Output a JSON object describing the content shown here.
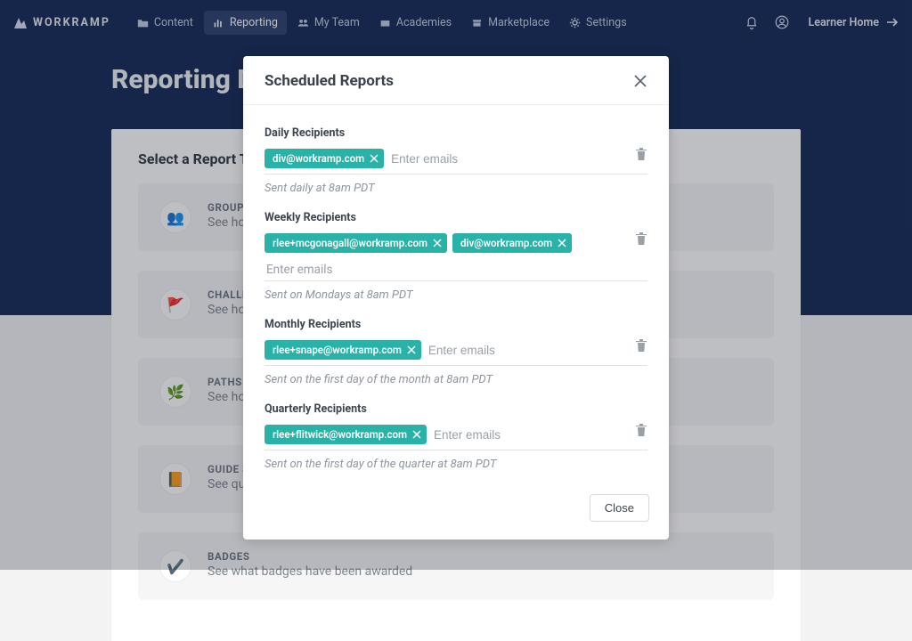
{
  "brand": "WORKRAMP",
  "nav": [
    {
      "label": "Content"
    },
    {
      "label": "Reporting"
    },
    {
      "label": "My Team"
    },
    {
      "label": "Academies"
    },
    {
      "label": "Marketplace"
    },
    {
      "label": "Settings"
    }
  ],
  "nav_active_index": 1,
  "learner_home": "Learner Home",
  "page_title": "Reporting Dashboard",
  "select_report_title": "Select a Report Type",
  "cards": [
    {
      "title": "GROUPS",
      "desc": "See how individual teams are performing on individual guides and paths"
    },
    {
      "title": "CHALLENGES",
      "desc": "See how individual teams are performing on individual challenges"
    },
    {
      "title": "PATHS",
      "desc": "See how individual teams are performing"
    },
    {
      "title": "GUIDE SUMMARY",
      "desc": "See questions and challenges"
    },
    {
      "title": "BADGES",
      "desc": "See what badges have been awarded"
    }
  ],
  "modal": {
    "title": "Scheduled Reports",
    "daily": {
      "title": "Daily Recipients",
      "chips": [
        "div@workramp.com"
      ],
      "placeholder": "Enter emails",
      "note": "Sent daily at 8am PDT"
    },
    "weekly": {
      "title": "Weekly Recipients",
      "chips": [
        "rlee+mcgonagall@workramp.com",
        "div@workramp.com"
      ],
      "placeholder": "Enter emails",
      "note": "Sent on Mondays at 8am PDT"
    },
    "monthly": {
      "title": "Monthly Recipients",
      "chips": [
        "rlee+snape@workramp.com"
      ],
      "placeholder": "Enter emails",
      "note": "Sent on the first day of the month at 8am PDT"
    },
    "quarterly": {
      "title": "Quarterly Recipients",
      "chips": [
        "rlee+flitwick@workramp.com"
      ],
      "placeholder": "Enter emails",
      "note": "Sent on the first day of the quarter at 8am PDT"
    },
    "close_button": "Close"
  }
}
